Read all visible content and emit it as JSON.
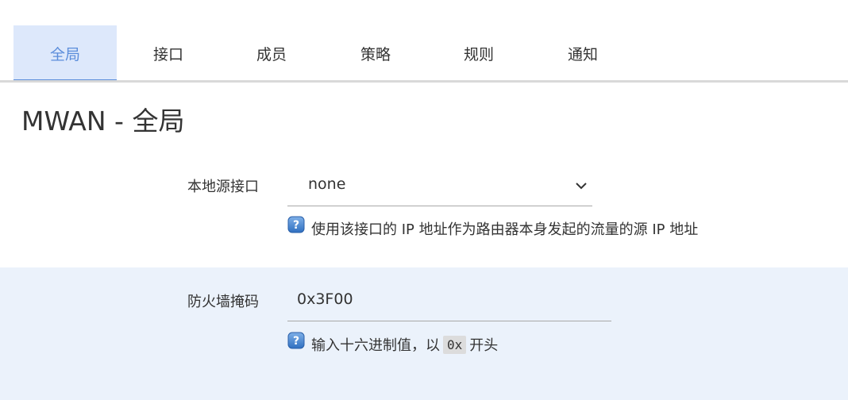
{
  "tabs": [
    {
      "label": "全局",
      "active": true
    },
    {
      "label": "接口",
      "active": false
    },
    {
      "label": "成员",
      "active": false
    },
    {
      "label": "策略",
      "active": false
    },
    {
      "label": "规则",
      "active": false
    },
    {
      "label": "通知",
      "active": false
    }
  ],
  "page": {
    "title": "MWAN - 全局"
  },
  "fields": {
    "local_source": {
      "label": "本地源接口",
      "value": "none",
      "help": "使用该接口的 IP 地址作为路由器本身发起的流量的源 IP 地址"
    },
    "firewall_mask": {
      "label": "防火墙掩码",
      "value": "0x3F00",
      "help_prefix": "输入十六进制值，以",
      "help_code": "0x",
      "help_suffix": "开头"
    }
  },
  "icons": {
    "help": "question-mark-icon",
    "dropdown": "chevron-down-icon"
  },
  "colors": {
    "accent": "#5b8ddb",
    "active_tab_bg": "#dde8fb",
    "alt_section_bg": "#ebf2fb"
  }
}
